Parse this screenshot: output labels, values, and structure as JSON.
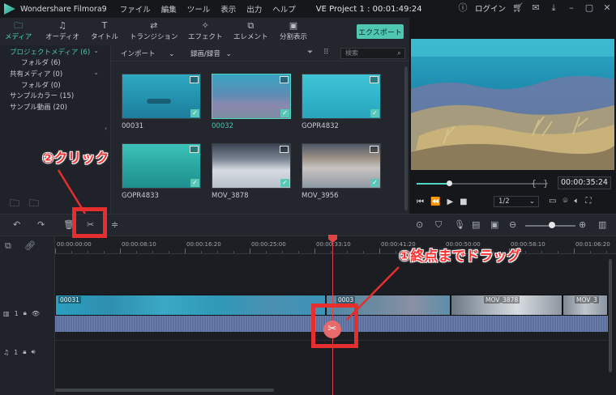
{
  "titlebar": {
    "app_name": "Wondershare Filmora9",
    "menu": [
      "ファイル",
      "編集",
      "ツール",
      "表示",
      "出力",
      "ヘルプ"
    ],
    "project": "VE Project 1 : 00:01:49:24",
    "login": "ログイン"
  },
  "tabs": [
    {
      "label": "メディア",
      "icon": "folder-icon"
    },
    {
      "label": "オーディオ",
      "icon": "music-note-icon"
    },
    {
      "label": "タイトル",
      "icon": "text-icon"
    },
    {
      "label": "トランジション",
      "icon": "transition-icon"
    },
    {
      "label": "エフェクト",
      "icon": "effects-icon"
    },
    {
      "label": "エレメント",
      "icon": "elements-icon"
    },
    {
      "label": "分割表示",
      "icon": "split-screen-icon"
    }
  ],
  "export_label": "エクスポート",
  "library": {
    "items": [
      {
        "label": "プロジェクトメディア (6)"
      },
      {
        "label": "フォルダ (6)"
      },
      {
        "label": "共有メディア (0)"
      },
      {
        "label": "フォルダ (0)"
      },
      {
        "label": "サンプルカラー (15)"
      },
      {
        "label": "サンプル動画 (20)"
      }
    ]
  },
  "browser": {
    "import_label": "インポート",
    "record_label": "録画/録音",
    "search_placeholder": "検索",
    "thumbs": [
      {
        "label": "00031"
      },
      {
        "label": "00032"
      },
      {
        "label": "GOPR4832"
      },
      {
        "label": "GOPR4833"
      },
      {
        "label": "MOV_3878"
      },
      {
        "label": "MOV_3956"
      }
    ]
  },
  "preview": {
    "timecode": "00:00:35:24",
    "ratio": "1/2",
    "progress": 0.25
  },
  "ruler": [
    "00:00:00:00",
    "00:00:08:10",
    "00:00:16:20",
    "00:00:25:00",
    "00:00:33:10",
    "00:00:41:20",
    "00:00:50:00",
    "00:00:58:10",
    "00:01:06:20"
  ],
  "timeline": {
    "video_track": "1",
    "audio_track": "1",
    "clips": [
      {
        "label": "00031"
      },
      {
        "label": "0003"
      },
      {
        "label": "MOV_3878"
      },
      {
        "label": "MOV_3"
      }
    ]
  },
  "annotations": {
    "click": "②クリック",
    "drag": "①終点までドラッグ"
  },
  "colors": {
    "accent": "#4fd6c0",
    "annotation_red": "#e62e2e",
    "playhead": "#e04545"
  }
}
